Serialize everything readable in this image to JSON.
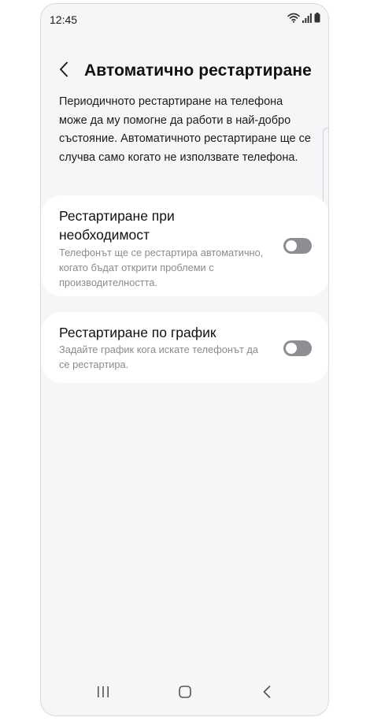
{
  "status_bar": {
    "time": "12:45",
    "icons": [
      "wifi-icon",
      "signal-icon",
      "battery-icon"
    ]
  },
  "header": {
    "back_icon": "chevron-left-icon",
    "title": "Автоматично рестартиране"
  },
  "description": "Периодичното рестартиране на телефона може да му помогне да работи в най-добро състояние. Автоматичното рестартиране ще се случва само когато не използвате телефона.",
  "settings": [
    {
      "title": "Рестартиране при необходимост",
      "subtitle": "Телефонът ще се рестартира автоматично, когато бъдат открити проблеми с производителността.",
      "enabled": false
    },
    {
      "title": "Рестартиране по график",
      "subtitle": "Задайте график кога искате телефонът да се рестартира.",
      "enabled": false
    }
  ],
  "nav_bar": {
    "icons": [
      "recent-apps-icon",
      "home-icon",
      "back-icon"
    ]
  },
  "colors": {
    "background": "#f6f5f8",
    "card": "#ffffff",
    "toggle_off": "#8e8e92",
    "secondary_text": "#8b8b8f"
  }
}
